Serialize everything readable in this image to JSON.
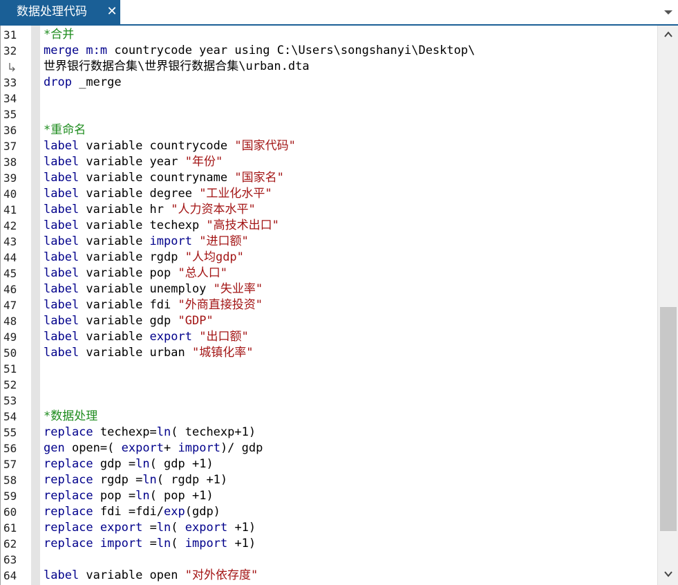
{
  "tab": {
    "title": "数据处理代码",
    "close_glyph": "✕"
  },
  "icons": {
    "close": "close-icon",
    "menu": "chevron-down-icon",
    "wrap": "word-wrap-icon",
    "scroll_up": "chevron-up-icon",
    "scroll_down": "chevron-down-icon"
  },
  "colors": {
    "tab_bg": "#1a5f96",
    "keyword": "#00008b",
    "comment": "#1e8c1e",
    "string": "#a31515"
  },
  "lines": [
    {
      "n": "31",
      "tokens": [
        [
          "*合并",
          "cm"
        ]
      ]
    },
    {
      "n": "32",
      "tokens": [
        [
          "merge m:m",
          "kw"
        ],
        [
          " countrycode year using C:\\Users\\songshanyi\\Desktop\\",
          ""
        ]
      ]
    },
    {
      "n": "",
      "wrap": true,
      "tokens": [
        [
          "世界银行数据合集\\世界银行数据合集\\urban.dta",
          ""
        ]
      ]
    },
    {
      "n": "33",
      "tokens": [
        [
          "drop",
          "kw"
        ],
        [
          " _merge",
          ""
        ]
      ]
    },
    {
      "n": "34",
      "tokens": []
    },
    {
      "n": "35",
      "tokens": []
    },
    {
      "n": "36",
      "tokens": [
        [
          "*重命名",
          "cm"
        ]
      ]
    },
    {
      "n": "37",
      "tokens": [
        [
          "label",
          "kw"
        ],
        [
          " variable countrycode ",
          ""
        ],
        [
          "\"国家代码\"",
          "st"
        ]
      ]
    },
    {
      "n": "38",
      "tokens": [
        [
          "label",
          "kw"
        ],
        [
          " variable year ",
          ""
        ],
        [
          "\"年份\"",
          "st"
        ]
      ]
    },
    {
      "n": "39",
      "tokens": [
        [
          "label",
          "kw"
        ],
        [
          " variable countryname ",
          ""
        ],
        [
          "\"国家名\"",
          "st"
        ]
      ]
    },
    {
      "n": "40",
      "tokens": [
        [
          "label",
          "kw"
        ],
        [
          " variable degree ",
          ""
        ],
        [
          "\"工业化水平\"",
          "st"
        ]
      ]
    },
    {
      "n": "41",
      "tokens": [
        [
          "label",
          "kw"
        ],
        [
          " variable hr ",
          ""
        ],
        [
          "\"人力资本水平\"",
          "st"
        ]
      ]
    },
    {
      "n": "42",
      "tokens": [
        [
          "label",
          "kw"
        ],
        [
          " variable techexp ",
          ""
        ],
        [
          "\"高技术出口\"",
          "st"
        ]
      ]
    },
    {
      "n": "43",
      "tokens": [
        [
          "label",
          "kw"
        ],
        [
          " variable ",
          ""
        ],
        [
          "import",
          "kw"
        ],
        [
          " ",
          ""
        ],
        [
          "\"进口额\"",
          "st"
        ]
      ]
    },
    {
      "n": "44",
      "tokens": [
        [
          "label",
          "kw"
        ],
        [
          " variable rgdp ",
          ""
        ],
        [
          "\"人均gdp\"",
          "st"
        ]
      ]
    },
    {
      "n": "45",
      "tokens": [
        [
          "label",
          "kw"
        ],
        [
          " variable pop ",
          ""
        ],
        [
          "\"总人口\"",
          "st"
        ]
      ]
    },
    {
      "n": "46",
      "tokens": [
        [
          "label",
          "kw"
        ],
        [
          " variable unemploy ",
          ""
        ],
        [
          "\"失业率\"",
          "st"
        ]
      ]
    },
    {
      "n": "47",
      "tokens": [
        [
          "label",
          "kw"
        ],
        [
          " variable fdi ",
          ""
        ],
        [
          "\"外商直接投资\"",
          "st"
        ]
      ]
    },
    {
      "n": "48",
      "tokens": [
        [
          "label",
          "kw"
        ],
        [
          " variable gdp ",
          ""
        ],
        [
          "\"GDP\"",
          "st"
        ]
      ]
    },
    {
      "n": "49",
      "tokens": [
        [
          "label",
          "kw"
        ],
        [
          " variable ",
          ""
        ],
        [
          "export",
          "kw"
        ],
        [
          " ",
          ""
        ],
        [
          "\"出口额\"",
          "st"
        ]
      ]
    },
    {
      "n": "50",
      "tokens": [
        [
          "label",
          "kw"
        ],
        [
          " variable urban ",
          ""
        ],
        [
          "\"城镇化率\"",
          "st"
        ]
      ]
    },
    {
      "n": "51",
      "tokens": []
    },
    {
      "n": "52",
      "tokens": []
    },
    {
      "n": "53",
      "tokens": []
    },
    {
      "n": "54",
      "tokens": [
        [
          "*数据处理",
          "cm"
        ]
      ]
    },
    {
      "n": "55",
      "tokens": [
        [
          "replace",
          "kw"
        ],
        [
          " techexp=",
          ""
        ],
        [
          "ln",
          "kw"
        ],
        [
          "( techexp+1)",
          ""
        ]
      ]
    },
    {
      "n": "56",
      "tokens": [
        [
          "gen",
          "kw"
        ],
        [
          " open=( ",
          ""
        ],
        [
          "export",
          "kw"
        ],
        [
          "+ ",
          ""
        ],
        [
          "import",
          "kw"
        ],
        [
          ")/ gdp",
          ""
        ]
      ]
    },
    {
      "n": "57",
      "tokens": [
        [
          "replace",
          "kw"
        ],
        [
          " gdp =",
          ""
        ],
        [
          "ln",
          "kw"
        ],
        [
          "( gdp +1)",
          ""
        ]
      ]
    },
    {
      "n": "58",
      "tokens": [
        [
          "replace",
          "kw"
        ],
        [
          " rgdp =",
          ""
        ],
        [
          "ln",
          "kw"
        ],
        [
          "( rgdp +1)",
          ""
        ]
      ]
    },
    {
      "n": "59",
      "tokens": [
        [
          "replace",
          "kw"
        ],
        [
          " pop =",
          ""
        ],
        [
          "ln",
          "kw"
        ],
        [
          "( pop +1)",
          ""
        ]
      ]
    },
    {
      "n": "60",
      "tokens": [
        [
          "replace",
          "kw"
        ],
        [
          " fdi =fdi/",
          ""
        ],
        [
          "exp",
          "kw"
        ],
        [
          "(gdp)",
          ""
        ]
      ]
    },
    {
      "n": "61",
      "tokens": [
        [
          "replace",
          "kw"
        ],
        [
          " ",
          ""
        ],
        [
          "export",
          "kw"
        ],
        [
          " =",
          ""
        ],
        [
          "ln",
          "kw"
        ],
        [
          "( ",
          ""
        ],
        [
          "export",
          "kw"
        ],
        [
          " +1)",
          ""
        ]
      ]
    },
    {
      "n": "62",
      "tokens": [
        [
          "replace",
          "kw"
        ],
        [
          " ",
          ""
        ],
        [
          "import",
          "kw"
        ],
        [
          " =",
          ""
        ],
        [
          "ln",
          "kw"
        ],
        [
          "( ",
          ""
        ],
        [
          "import",
          "kw"
        ],
        [
          " +1)",
          ""
        ]
      ]
    },
    {
      "n": "63",
      "tokens": []
    },
    {
      "n": "64",
      "tokens": [
        [
          "label",
          "kw"
        ],
        [
          " variable open ",
          ""
        ],
        [
          "\"对外依存度\"",
          "st"
        ]
      ]
    }
  ]
}
